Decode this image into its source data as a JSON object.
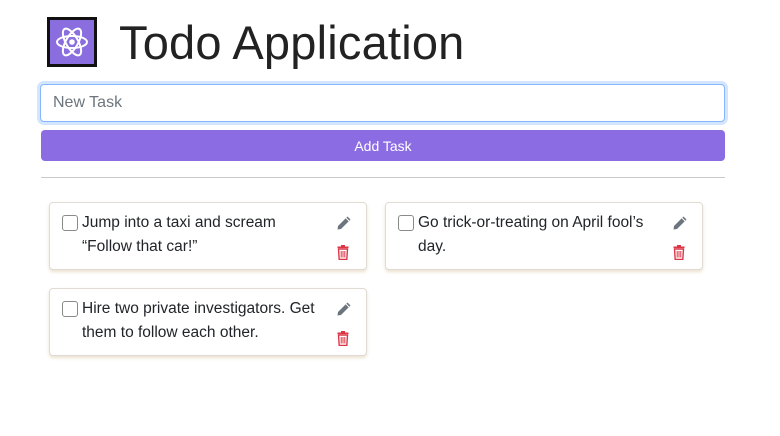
{
  "header": {
    "title": "Todo Application",
    "logo_icon": "atom-icon"
  },
  "new_task": {
    "placeholder": "New Task",
    "value": ""
  },
  "add_button": {
    "label": "Add Task"
  },
  "tasks": [
    {
      "text": "Jump into a taxi and scream “Follow that car!”",
      "completed": false
    },
    {
      "text": "Go trick-or-treating on April fool’s day.",
      "completed": false
    },
    {
      "text": "Hire two private investigators. Get them to follow each other.",
      "completed": false
    }
  ],
  "colors": {
    "accent": "#8b6ce2",
    "delete": "#dc3545",
    "edit": "#6c757d"
  }
}
